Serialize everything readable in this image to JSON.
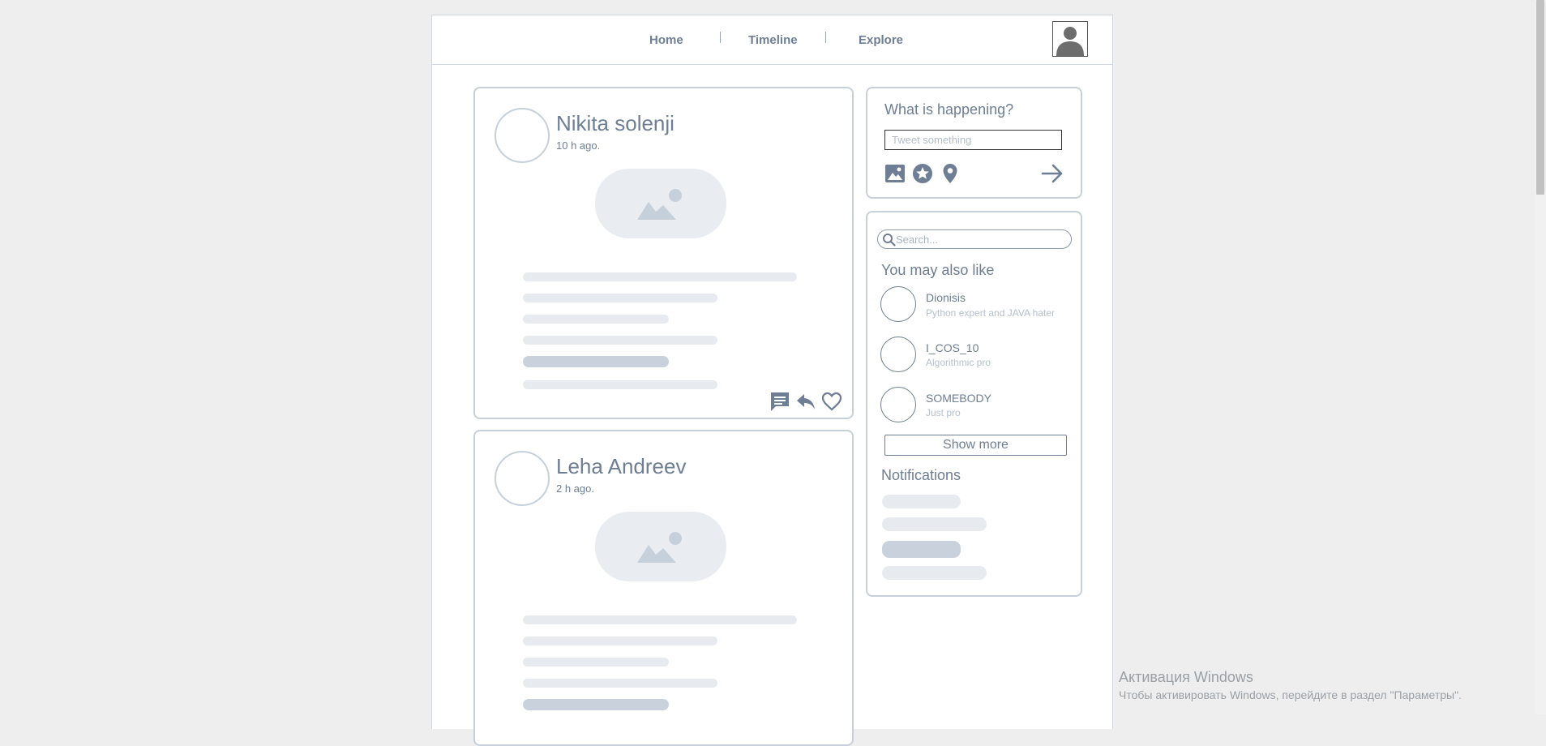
{
  "nav": {
    "home": "Home",
    "timeline": "Timeline",
    "explore": "Explore"
  },
  "posts": [
    {
      "author": "Nikita solenji",
      "time": "10 h ago."
    },
    {
      "author": "Leha Andreev",
      "time": "2 h ago."
    }
  ],
  "compose": {
    "title": "What is happening?",
    "placeholder": "Tweet something",
    "icons": [
      "image-icon",
      "star-icon",
      "location-pin-icon",
      "arrow-right-icon"
    ]
  },
  "sidebar": {
    "search_placeholder": "Search...",
    "suggestions_title": "You may also like",
    "suggestions": [
      {
        "name": "Dionisis",
        "desc": "Python expert and JAVA hater"
      },
      {
        "name": "I_COS_10",
        "desc": "Algorithmic pro"
      },
      {
        "name": "SOMEBODY",
        "desc": "Just pro"
      }
    ],
    "show_more": "Show more",
    "notifications_title": "Notifications"
  },
  "watermark": {
    "line1": "Активация Windows",
    "line2": "Чтобы активировать Windows, перейдите в раздел \"Параметры\"."
  },
  "colors": {
    "accent": "#6e7e94",
    "border": "#c6d0db",
    "placeholder": "#e7ebf0"
  }
}
